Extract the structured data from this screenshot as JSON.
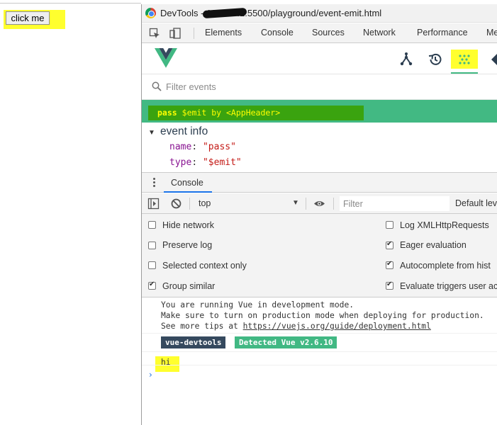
{
  "page": {
    "button_label": "click me"
  },
  "window": {
    "title": "DevTools - 127.0.0.1:5500/playground/event-emit.html"
  },
  "devtools_tabs": [
    "Elements",
    "Console",
    "Sources",
    "Network",
    "Performance",
    "Me"
  ],
  "vue_devtools": {
    "nav_icons": [
      "components-icon",
      "history-icon",
      "events-icon",
      "vuex-icon"
    ],
    "filter_placeholder": "Filter events",
    "event_row": {
      "name": "pass",
      "type": "$emit",
      "by": "by",
      "source": "<AppHeader>"
    },
    "event_info": {
      "title": "event info",
      "props": [
        {
          "key": "name",
          "value": "\"pass\""
        },
        {
          "key": "type",
          "value": "\"$emit\""
        }
      ]
    }
  },
  "console": {
    "tab_label": "Console",
    "context": "top",
    "filter_placeholder": "Filter",
    "levels_label": "Default lev",
    "settings_left": [
      {
        "label": "Hide network",
        "checked": false
      },
      {
        "label": "Preserve log",
        "checked": false
      },
      {
        "label": "Selected context only",
        "checked": false
      },
      {
        "label": "Group similar",
        "checked": true
      }
    ],
    "settings_right": [
      {
        "label": "Log XMLHttpRequests",
        "checked": false
      },
      {
        "label": "Eager evaluation",
        "checked": true
      },
      {
        "label": "Autocomplete from hist",
        "checked": true
      },
      {
        "label": "Evaluate triggers user ac",
        "checked": true
      }
    ],
    "messages": {
      "line1": "You are running Vue in development mode.",
      "line2": "Make sure to turn on production mode when deploying for production.",
      "line3_prefix": "See more tips at ",
      "line3_link": "https://vuejs.org/guide/deployment.html",
      "badge_dark": "vue-devtools",
      "badge_green": "Detected Vue v2.6.10",
      "log_output": "hi",
      "prompt": "›"
    }
  }
}
